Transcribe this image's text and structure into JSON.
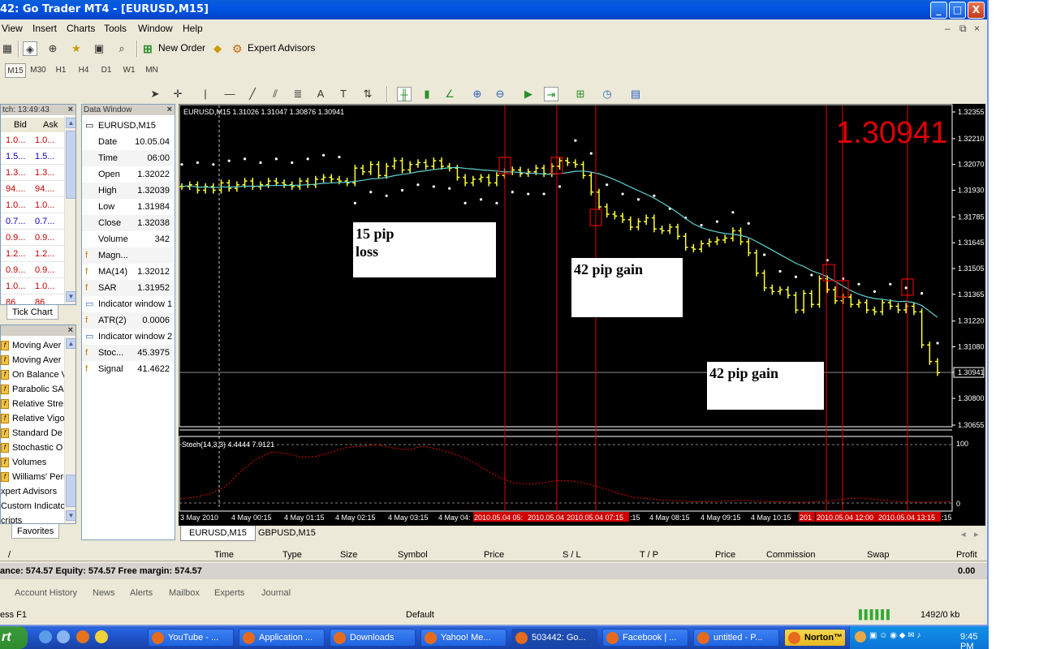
{
  "window": {
    "title": "42: Go Trader MT4 - [EURUSD,M15]",
    "min": "_",
    "max": "□",
    "close": "X"
  },
  "menu": [
    "View",
    "Insert",
    "Charts",
    "Tools",
    "Window",
    "Help"
  ],
  "mdi_controls": [
    "–",
    "⧉",
    "×"
  ],
  "toolbar": {
    "new_order": "New Order",
    "expert_advisors": "Expert Advisors"
  },
  "timeframes": [
    "M15",
    "M30",
    "H1",
    "H4",
    "D1",
    "W1",
    "MN"
  ],
  "market_watch": {
    "title": "tch: 13:49:43",
    "headers": [
      "Bid",
      "Ask"
    ],
    "rows": [
      {
        "bid": "1.0...",
        "ask": "1.0...",
        "color": "#c00000"
      },
      {
        "bid": "1.5...",
        "ask": "1.5...",
        "color": "#0000c0"
      },
      {
        "bid": "1.3...",
        "ask": "1.3...",
        "color": "#c00000"
      },
      {
        "bid": "94....",
        "ask": "94....",
        "color": "#c00000"
      },
      {
        "bid": "1.0...",
        "ask": "1.0...",
        "color": "#c00000"
      },
      {
        "bid": "0.7...",
        "ask": "0.7...",
        "color": "#0000c0"
      },
      {
        "bid": "0.9...",
        "ask": "0.9...",
        "color": "#c00000"
      },
      {
        "bid": "1.2...",
        "ask": "1.2...",
        "color": "#c00000"
      },
      {
        "bid": "0.9...",
        "ask": "0.9...",
        "color": "#c00000"
      },
      {
        "bid": "1.0...",
        "ask": "1.0...",
        "color": "#c00000"
      },
      {
        "bid": "86",
        "ask": "86",
        "color": "#c00000"
      }
    ],
    "tab": "Tick Chart"
  },
  "data_window": {
    "title": "Data Window",
    "symbol": "EURUSD,M15",
    "rows": [
      {
        "label": "Date",
        "value": "10.05.04"
      },
      {
        "label": "Time",
        "value": "06:00"
      },
      {
        "label": "Open",
        "value": "1.32022"
      },
      {
        "label": "High",
        "value": "1.32039"
      },
      {
        "label": "Low",
        "value": "1.31984"
      },
      {
        "label": "Close",
        "value": "1.32038"
      },
      {
        "label": "Volume",
        "value": "342"
      },
      {
        "label": "Magn...",
        "value": ""
      },
      {
        "label": "MA(14)",
        "value": "1.32012"
      },
      {
        "label": "SAR",
        "value": "1.31952"
      },
      {
        "label": "Indicator window 1",
        "value": ""
      },
      {
        "label": "ATR(2)",
        "value": "0.0006"
      },
      {
        "label": "Indicator window 2",
        "value": ""
      },
      {
        "label": "Stoc...",
        "value": "45.3975"
      },
      {
        "label": "Signal",
        "value": "41.4622"
      }
    ]
  },
  "navigator": {
    "items": [
      "Moving Aver",
      "Moving Aver",
      "On Balance V",
      "Parabolic SA",
      "Relative Stre",
      "Relative Vigo",
      "Standard De",
      "Stochastic O",
      "Volumes",
      "Williams' Perc",
      "xpert Advisors",
      "Custom Indicator",
      "cripts"
    ],
    "tab": "Favorites"
  },
  "chart": {
    "header": "EURUSD,M15  1.31026 1.31047 1.30876 1.30941",
    "big_price": "1.30941",
    "price_ticks": [
      "1.32355",
      "1.32210",
      "1.32070",
      "1.31930",
      "1.31785",
      "1.31645",
      "1.31505",
      "1.31365",
      "1.31220",
      "1.31080",
      "1.30941",
      "1.30800",
      "1.30655"
    ],
    "stoch_header": "Stoch(14,3,3) 4.4444 7.9121",
    "stoch_ticks": [
      "100",
      "0"
    ],
    "time_labels": [
      "3 May 2010",
      "4 May 00:15",
      "4 May 01:15",
      "4 May 02:15",
      "4 May 03:15",
      "4 May 04:",
      "2010.05.04 05:",
      "2010.05.04",
      "2010.05.04 07:15",
      ":15",
      "4 May 08:15",
      "4 May 09:15",
      "4 May 10:15",
      "201",
      "2010.05.04 12:00",
      "2010.05.04 13:15",
      ":15"
    ],
    "annotations": [
      {
        "line1": "15 pip",
        "line2": "loss"
      },
      {
        "line1": "42 pip gain",
        "line2": ""
      },
      {
        "line1": "42 pip gain",
        "line2": ""
      }
    ],
    "colors": {
      "candle": "#ffff33",
      "ma": "#5fd3d3",
      "sar": "#ffffff",
      "signal_line": "#e00000",
      "big_price": "#e00000",
      "stoch": "#e00000"
    }
  },
  "chart_tabs": [
    "EURUSD,M15",
    "GBPUSD,M15"
  ],
  "terminal": {
    "headers": [
      "/",
      "Time",
      "Type",
      "Size",
      "Symbol",
      "Price",
      "S / L",
      "T / P",
      "Price",
      "Commission",
      "Swap",
      "Profit"
    ],
    "balance_text": "ance: 574.57  Equity: 574.57  Free margin: 574.57",
    "profit": "0.00",
    "tabs": [
      "Account History",
      "News",
      "Alerts",
      "Mailbox",
      "Experts",
      "Journal"
    ]
  },
  "status": {
    "help": "ess F1",
    "profile": "Default",
    "traffic": "1492/0 kb"
  },
  "taskbar": {
    "start": "rt",
    "tasks": [
      "YouTube - ...",
      "Application ...",
      "Downloads",
      "Yahoo! Me...",
      "503442: Go...",
      "Facebook | ...",
      "untitled - P...",
      "Norton™"
    ],
    "clock": "9:45 PM"
  }
}
